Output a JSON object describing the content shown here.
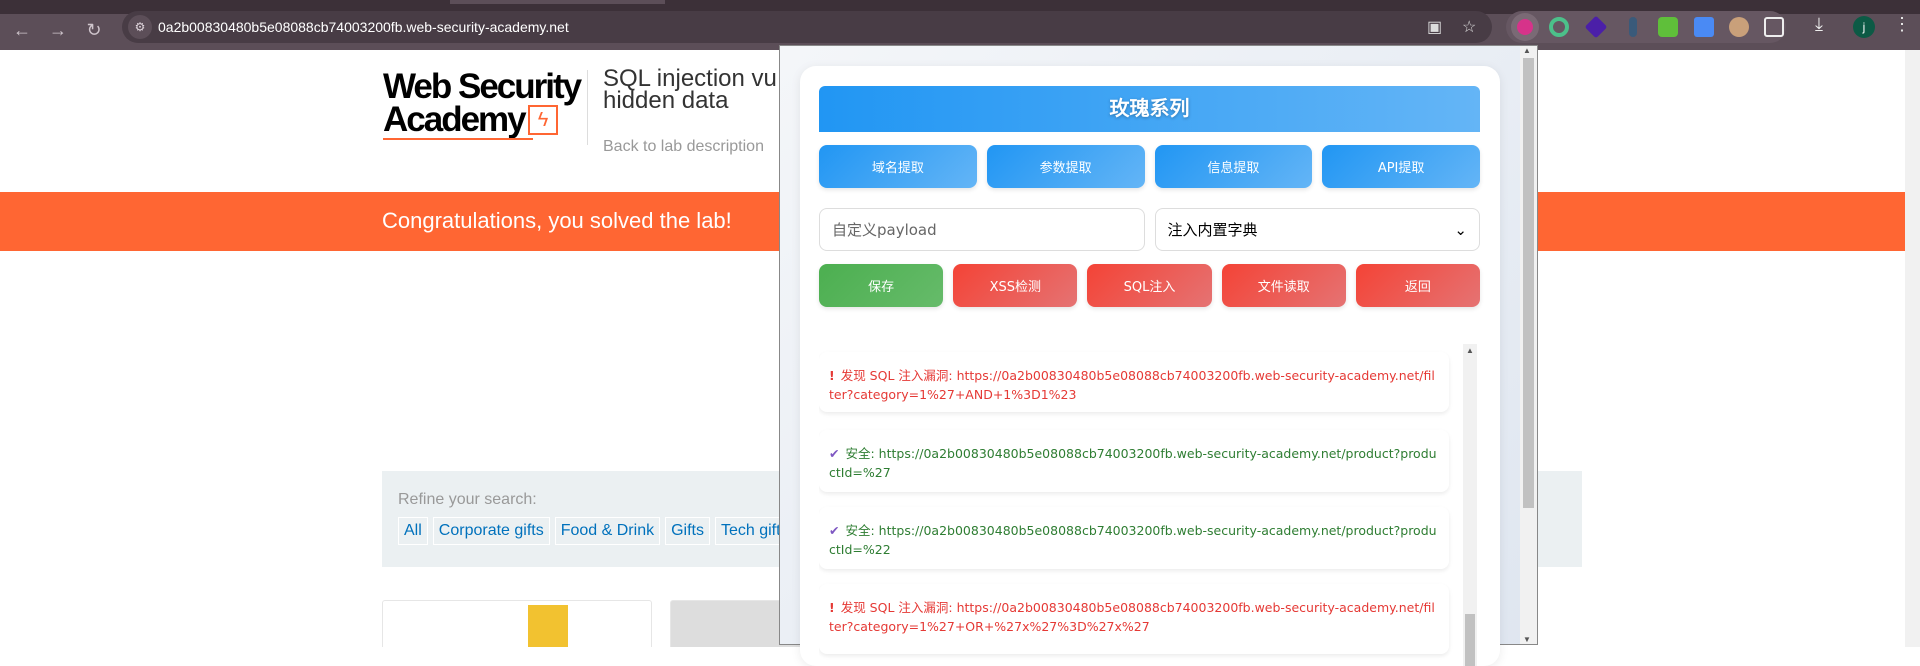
{
  "browser": {
    "url": "0a2b00830480b5e08088cb74003200fb.web-security-academy.net",
    "profile_initial": "j",
    "extensions": [
      "rose-extension",
      "circle-extension",
      "layers-extension",
      "wayback-extension",
      "puzzle-green-extension",
      "translate-extension",
      "owl-extension",
      "extensions-puzzle"
    ]
  },
  "page": {
    "logo": {
      "line1": "Web Security",
      "line2": "Academy"
    },
    "lab_title": "SQL injection vu\nhidden data",
    "lab_title_line1": "SQL injection vu",
    "lab_title_line2": "hidden data",
    "back_link": "Back to lab description",
    "banner": "Congratulations, you solved the lab!",
    "filter": {
      "label": "Refine your search:",
      "chips": [
        "All",
        "Corporate gifts",
        "Food & Drink",
        "Gifts",
        "Tech gift"
      ]
    },
    "colors": {
      "accent": "#ff6633",
      "link": "#0071bc"
    }
  },
  "popup": {
    "title": "玫瑰系列",
    "row1": [
      "域名提取",
      "参数提取",
      "信息提取",
      "API提取"
    ],
    "payload_placeholder": "自定义payload",
    "dict_select": "注入内置字典",
    "row3": [
      {
        "label": "保存",
        "kind": "green"
      },
      {
        "label": "XSS检测",
        "kind": "red"
      },
      {
        "label": "SQL注入",
        "kind": "red"
      },
      {
        "label": "文件读取",
        "kind": "red"
      },
      {
        "label": "返回",
        "kind": "red"
      }
    ],
    "log": [
      {
        "status": "vuln",
        "icon": "exclamation-icon",
        "text": "发现 SQL 注入漏洞: https://0a2b00830480b5e08088cb74003200fb.web-security-academy.net/filter?category=1%27+AND+1%3D1%23"
      },
      {
        "status": "safe",
        "icon": "check-icon",
        "text": "安全: https://0a2b00830480b5e08088cb74003200fb.web-security-academy.net/product?productId=%27"
      },
      {
        "status": "safe",
        "icon": "check-icon",
        "text": "安全: https://0a2b00830480b5e08088cb74003200fb.web-security-academy.net/product?productId=%22"
      },
      {
        "status": "vuln",
        "icon": "exclamation-icon",
        "text": "发现 SQL 注入漏洞: https://0a2b00830480b5e08088cb74003200fb.web-security-academy.net/filter?category=1%27+OR+%27x%27%3D%27x%27"
      }
    ],
    "colors": {
      "blue": "#2196f3",
      "red": "#f44336",
      "green": "#4caf50"
    }
  }
}
